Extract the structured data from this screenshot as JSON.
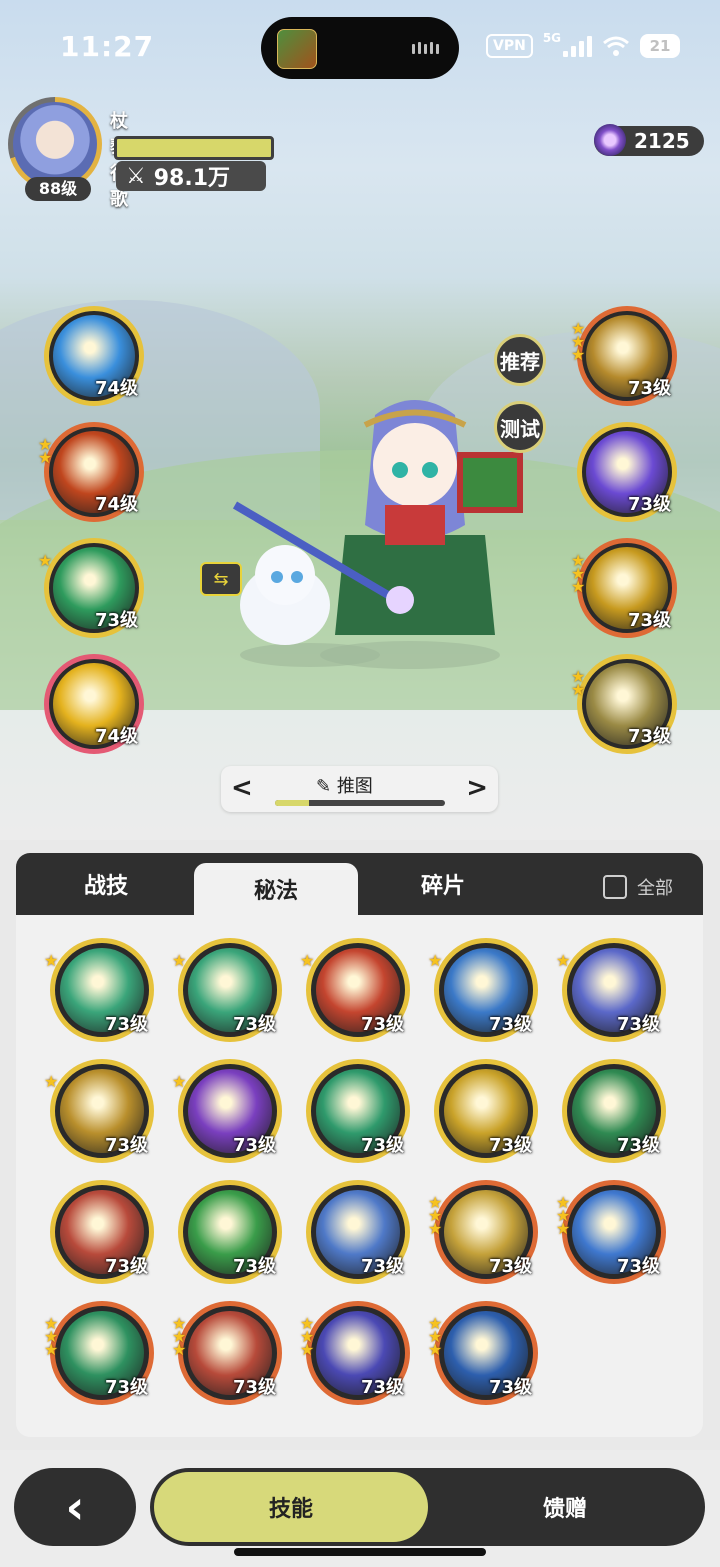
{
  "status_bar": {
    "time": "11:27",
    "vpn": "VPN",
    "network": "5G",
    "battery": "21"
  },
  "player": {
    "name": "杖藜行歌",
    "level": "88级",
    "power": "98.1万"
  },
  "currency": {
    "amount": "2125"
  },
  "side_buttons": {
    "recommend": "推荐",
    "test": "测试"
  },
  "equipped_left": [
    {
      "level": "74级",
      "stars": 0,
      "ring": "gold",
      "color": "#3a8fdc"
    },
    {
      "level": "74级",
      "stars": 2,
      "ring": "orange",
      "color": "#c0461e"
    },
    {
      "level": "73级",
      "stars": 1,
      "ring": "gold",
      "color": "#2e9b5d"
    },
    {
      "level": "74级",
      "stars": 0,
      "ring": "pink",
      "color": "#e4b21e"
    }
  ],
  "equipped_right": [
    {
      "level": "73级",
      "stars": 3,
      "ring": "orange",
      "color": "#b58a2c"
    },
    {
      "level": "73级",
      "stars": 0,
      "ring": "gold",
      "color": "#6b4ad3"
    },
    {
      "level": "73级",
      "stars": 3,
      "ring": "orange",
      "color": "#c79a1f"
    },
    {
      "level": "73级",
      "stars": 2,
      "ring": "gold",
      "color": "#9a8a45"
    }
  ],
  "stage": {
    "title": "推图",
    "progress": 0.2
  },
  "tabs": [
    {
      "label": "战技",
      "active": false
    },
    {
      "label": "秘法",
      "active": true
    },
    {
      "label": "碎片",
      "active": false
    }
  ],
  "check_all_label": "全部",
  "skill_grid": [
    {
      "level": "73级",
      "stars": 1,
      "ring": "gold",
      "color": "#3aa57a"
    },
    {
      "level": "73级",
      "stars": 1,
      "ring": "gold",
      "color": "#3aa57a"
    },
    {
      "level": "73级",
      "stars": 1,
      "ring": "gold",
      "color": "#c4452f"
    },
    {
      "level": "73级",
      "stars": 1,
      "ring": "gold",
      "color": "#3b79c8"
    },
    {
      "level": "73级",
      "stars": 1,
      "ring": "gold",
      "color": "#5b68c9"
    },
    {
      "level": "73级",
      "stars": 1,
      "ring": "gold",
      "color": "#b98f2c"
    },
    {
      "level": "73级",
      "stars": 1,
      "ring": "gold",
      "color": "#7a3fbf"
    },
    {
      "level": "73级",
      "stars": 0,
      "ring": "gold",
      "color": "#2f9a6c"
    },
    {
      "level": "73级",
      "stars": 0,
      "ring": "gold",
      "color": "#c9a229"
    },
    {
      "level": "73级",
      "stars": 0,
      "ring": "gold",
      "color": "#2f8a52"
    },
    {
      "level": "73级",
      "stars": 0,
      "ring": "gold",
      "color": "#b84a3b"
    },
    {
      "level": "73级",
      "stars": 0,
      "ring": "gold",
      "color": "#3a9d4a"
    },
    {
      "level": "73级",
      "stars": 0,
      "ring": "gold",
      "color": "#4f79c8"
    },
    {
      "level": "73级",
      "stars": 3,
      "ring": "orange",
      "color": "#c4a13a"
    },
    {
      "level": "73级",
      "stars": 3,
      "ring": "orange",
      "color": "#3f78cf"
    },
    {
      "level": "73级",
      "stars": 3,
      "ring": "orange",
      "color": "#2e9160"
    },
    {
      "level": "73级",
      "stars": 3,
      "ring": "orange",
      "color": "#b74a3a"
    },
    {
      "level": "73级",
      "stars": 3,
      "ring": "orange",
      "color": "#4b49b4"
    },
    {
      "level": "73级",
      "stars": 3,
      "ring": "orange",
      "color": "#2d5fae"
    }
  ],
  "bottom_nav": {
    "back_icon": "chevron-left-icon",
    "active": "技能",
    "other": "馈赠"
  }
}
